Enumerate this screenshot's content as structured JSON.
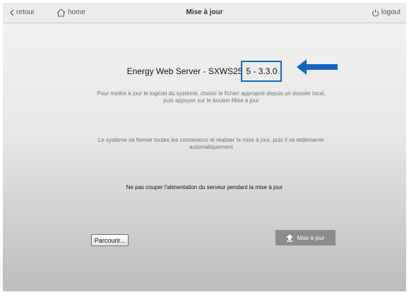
{
  "topbar": {
    "back_label": "retour",
    "home_label": "home",
    "title": "Mise à jour",
    "logout_label": "logout"
  },
  "main": {
    "product_prefix": "Energy Web Server - SXWS25",
    "version_highlight": "5 - 3.3.0",
    "instruction_1": "Pour mettre à jour le logiciel du système, choisir le fichier approprié depuis un dossier local, puis appuyer sur le bouton Mise à jour",
    "instruction_2": "Le système va fermer toutes les connexions et réaliser la mise à jour, puis il va redémarrer automatiquement",
    "warning": "Ne pas couper l'alimentation du serveur pendant la mise à jour",
    "browse_label": "Parcourir...",
    "update_label": "Mise à jour"
  },
  "annotation": {
    "highlight_color": "#1565c0"
  }
}
